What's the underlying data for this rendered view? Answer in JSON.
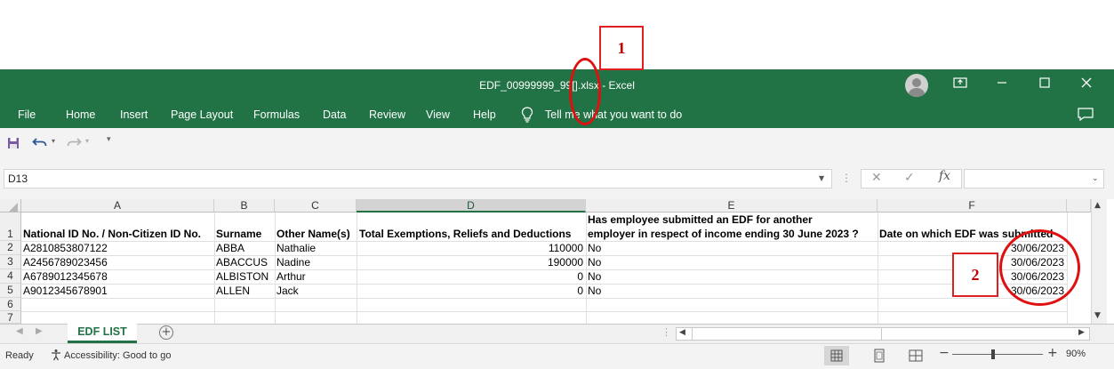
{
  "window": {
    "title": "EDF_00999999_99[].xlsx  -  Excel",
    "accent": "#217346"
  },
  "ribbon": {
    "tabs": [
      "File",
      "Home",
      "Insert",
      "Page Layout",
      "Formulas",
      "Data",
      "Review",
      "View",
      "Help"
    ],
    "tell_me": "Tell me what you want to do"
  },
  "formula_bar": {
    "name_box": "D13",
    "fx": "fx",
    "content": ""
  },
  "grid": {
    "columns": [
      "A",
      "B",
      "C",
      "D",
      "E",
      "F"
    ],
    "selected_column": "D",
    "row_numbers": [
      "1",
      "2",
      "3",
      "4",
      "5",
      "6",
      "7"
    ],
    "header_row": {
      "a": "National ID No. / Non-Citizen ID No.",
      "b": "Surname",
      "c": "Other Name(s)",
      "d": "Total Exemptions, Reliefs and Deductions",
      "e_line1": "Has employee submitted an EDF for another",
      "e_line2": "employer in respect of income ending 30 June 2023 ?",
      "f": "Date on which EDF was submitted"
    },
    "rows": [
      {
        "id": "A2810853807122",
        "surname": "ABBA",
        "other": "Nathalie",
        "total": "110000",
        "submitted": "No",
        "date": "30/06/2023"
      },
      {
        "id": "A2456789023456",
        "surname": "ABACCUS",
        "other": "Nadine",
        "total": "190000",
        "submitted": "No",
        "date": "30/06/2023"
      },
      {
        "id": "A6789012345678",
        "surname": "ALBISTON",
        "other": "Arthur",
        "total": "0",
        "submitted": "No",
        "date": "30/06/2023"
      },
      {
        "id": "A9012345678901",
        "surname": "ALLEN",
        "other": "Jack",
        "total": "0",
        "submitted": "No",
        "date": "30/06/2023"
      }
    ]
  },
  "sheets": {
    "active": "EDF LIST",
    "add": "+"
  },
  "status": {
    "ready": "Ready",
    "accessibility": "Accessibility: Good to go",
    "zoom_minus": "−",
    "zoom_plus": "+",
    "zoom": "90%"
  },
  "annotations": {
    "label_1": "1",
    "label_2": "2",
    "color": "#e02020"
  }
}
